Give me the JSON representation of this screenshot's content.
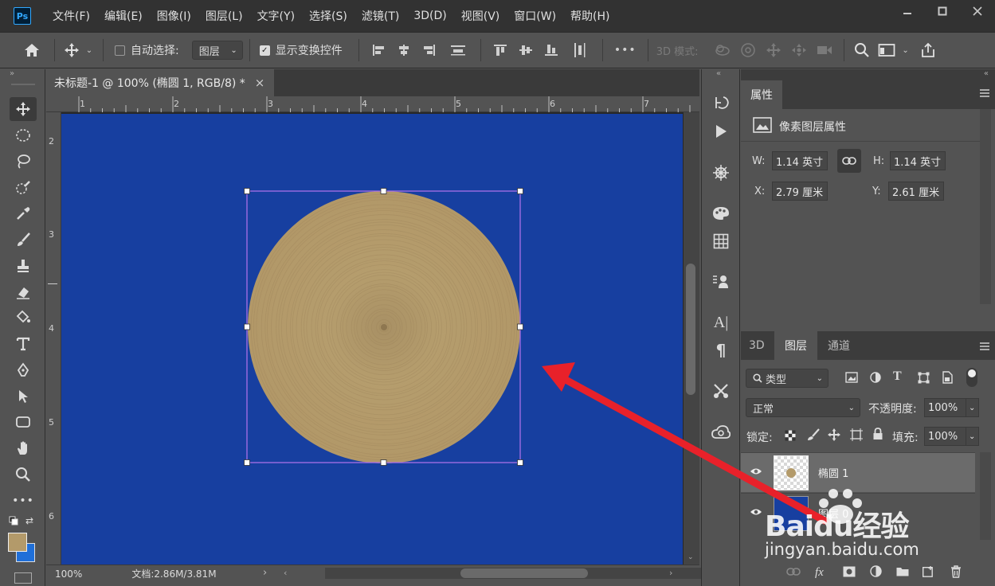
{
  "app": {
    "logo": "Ps",
    "menu": [
      "文件(F)",
      "编辑(E)",
      "图像(I)",
      "图层(L)",
      "文字(Y)",
      "选择(S)",
      "滤镜(T)",
      "3D(D)",
      "视图(V)",
      "窗口(W)",
      "帮助(H)"
    ]
  },
  "options_bar": {
    "auto_select_label": "自动选择:",
    "auto_select_value": "图层",
    "show_transform_label": "显示变换控件",
    "mode_3d_label": "3D 模式:",
    "more": "•••"
  },
  "document": {
    "tab_title": "未标题-1 @ 100% (椭圆 1, RGB/8) *",
    "close": "×",
    "ruler_top": [
      "1",
      "2",
      "3",
      "4",
      "5",
      "6",
      "7"
    ],
    "ruler_left": [
      "2",
      "3",
      "4",
      "5",
      "6"
    ],
    "zoom": "100%",
    "doc_info": "文档:2.86M/3.81M",
    "canvas_color": "#173fa0",
    "circle_color": "#b39a6a",
    "selection_color": "#a86ee8",
    "arrow_color": "#e8212a"
  },
  "properties": {
    "tab": "属性",
    "subtitle": "像素图层属性",
    "w_label": "W:",
    "w_value": "1.14 英寸",
    "h_label": "H:",
    "h_value": "1.14 英寸",
    "x_label": "X:",
    "x_value": "2.79 厘米",
    "y_label": "Y:",
    "y_value": "2.61 厘米"
  },
  "layers_panel": {
    "tabs": [
      "3D",
      "图层",
      "通道"
    ],
    "filter_label": "类型",
    "blend_mode": "正常",
    "opacity_label": "不透明度:",
    "opacity_value": "100%",
    "lock_label": "锁定:",
    "fill_label": "填充:",
    "fill_value": "100%",
    "layers": [
      {
        "name": "椭圆 1",
        "selected": true
      },
      {
        "name": "图层 0",
        "selected": false
      }
    ]
  },
  "watermark": {
    "brand": "Baidu经验",
    "url": "jingyan.baidu.com"
  }
}
